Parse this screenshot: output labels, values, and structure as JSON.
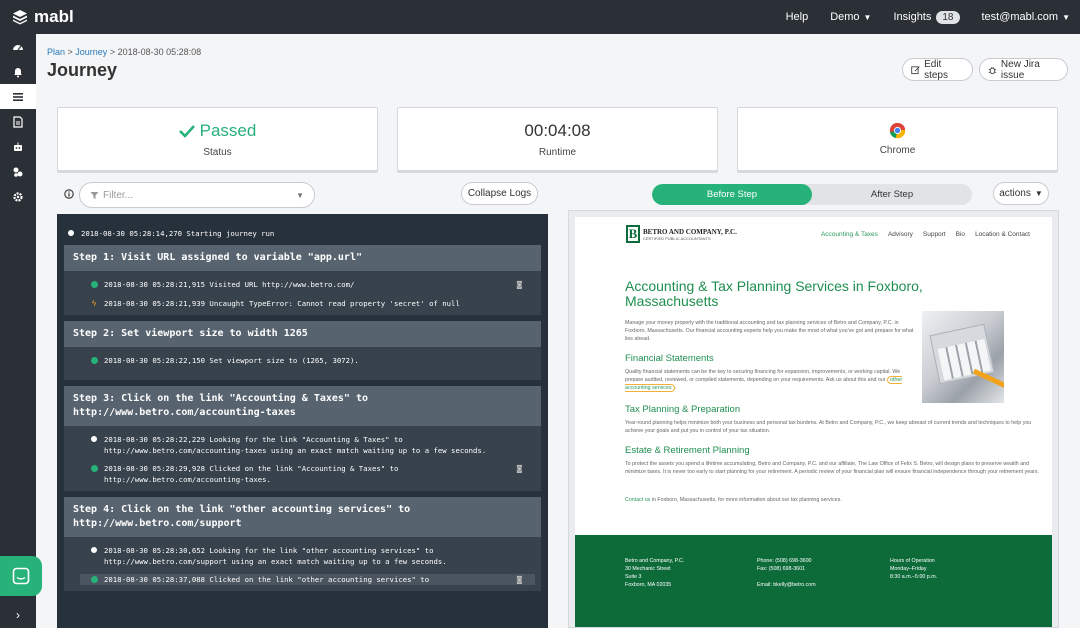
{
  "topbar": {
    "brand": "mabl",
    "help": "Help",
    "demo": "Demo",
    "insights": "Insights",
    "insights_count": "18",
    "user": "test@mabl.com"
  },
  "sidebar": {
    "items": [
      "dashboard-icon",
      "bell-icon",
      "list-icon",
      "document-icon",
      "robot-icon",
      "puzzle-icon",
      "gear-icon"
    ],
    "active_index": 2,
    "expand": "›"
  },
  "header": {
    "breadcrumb_plan": "Plan",
    "breadcrumb_sep1": " > ",
    "breadcrumb_journey": "Journey",
    "breadcrumb_sep2": " > ",
    "breadcrumb_run": "2018-08-30 05:28:08",
    "title": "Journey",
    "edit_steps": "Edit steps",
    "new_jira": "New Jira issue"
  },
  "cards": {
    "status_value": "Passed",
    "status_label": "Status",
    "runtime_value": "00:04:08",
    "runtime_label": "Runtime",
    "browser_label": "Chrome"
  },
  "toolbar": {
    "filter_placeholder": "Filter...",
    "collapse_logs": "Collapse Logs",
    "before_step": "Before Step",
    "after_step": "After Step",
    "actions": "actions"
  },
  "log": {
    "start": "2018-08-30 05:28:14,270 Starting journey run",
    "steps": [
      {
        "title": "Step 1: Visit URL assigned to variable \"app.url\"",
        "lines": [
          {
            "icon": "ok",
            "text": "2018-08-30 05:28:21,915 Visited URL http://www.betro.com/",
            "camera": true
          },
          {
            "icon": "warn",
            "text": "2018-08-30 05:28:21,939 Uncaught TypeError: Cannot read property 'secret' of null",
            "camera": false
          }
        ]
      },
      {
        "title": "Step 2: Set viewport size to width 1265",
        "lines": [
          {
            "icon": "ok",
            "text": "2018-08-30 05:28:22,150 Set viewport size to (1265, 3072).",
            "camera": false
          }
        ]
      },
      {
        "title": "Step 3: Click on the link \"Accounting & Taxes\" to http://www.betro.com/accounting-taxes",
        "lines": [
          {
            "icon": "info",
            "text": "2018-08-30 05:28:22,229 Looking for the link \"Accounting & Taxes\" to http://www.betro.com/accounting-taxes using an exact match waiting up to a few seconds.",
            "camera": false
          },
          {
            "icon": "ok",
            "text": "2018-08-30 05:28:29,928 Clicked on the link \"Accounting & Taxes\" to http://www.betro.com/accounting-taxes.",
            "camera": true
          }
        ]
      },
      {
        "title": "Step 4: Click on the link \"other accounting services\" to http://www.betro.com/support",
        "lines": [
          {
            "icon": "info",
            "text": "2018-08-30 05:28:30,652 Looking for the link \"other accounting services\" to http://www.betro.com/support using an exact match waiting up to a few seconds.",
            "camera": false
          },
          {
            "icon": "ok",
            "text": "2018-08-30 05:28:37,088 Clicked on the link \"other accounting services\" to",
            "camera": true
          }
        ]
      }
    ]
  },
  "site": {
    "brand": "BETRO AND COMPANY, P.C.",
    "brand_sub": "CERTIFIED PUBLIC ACCOUNTANTS",
    "logo_letter": "B",
    "nav": [
      "Accounting & Taxes",
      "Advisory",
      "Support",
      "Bio",
      "Location & Contact"
    ],
    "heading": "Accounting & Tax Planning Services in Foxboro, Massachusetts",
    "intro": "Manage your money properly with the traditional accounting and tax planning services of Betro and Company, P.C. in Foxboro, Massachusetts. Our financial accounting experts help you make the most of what you've got and prepare for what lies ahead.",
    "fin_title": "Financial Statements",
    "fin_text": "Quality financial statements can be the key to securing financing for expansion, improvements, or working capital. We prepare audited, reviewed, or compiled statements, depending on your requirements. Ask us about this and our",
    "fin_link": "other accounting services",
    "fin_end": ".",
    "tax_title": "Tax Planning & Preparation",
    "tax_text": "Year-round planning helps minimize both your business and personal tax burdens. At Betro and Company, P.C., we keep abreast of current trends and techniques to help you achieve your goals and put you in control of your tax situation.",
    "estate_title": "Estate & Retirement Planning",
    "estate_text": "To protect the assets you spend a lifetime accumulating, Betro and Company, P.C. and our affiliate, The Law Office of Felix S. Betro, will design plans to preserve wealth and minimize taxes. It is never too early to start planning for your retirement. A periodic review of your financial plan will ensure financial independence through your retirement years.",
    "contact_link": "Contact us",
    "contact_text": " in Foxboro, Massachusetts, for more information about our tax planning services.",
    "footer": {
      "col1": [
        "Betro and Company, P.C.",
        "30 Mechanic Street",
        "Suite 3",
        "Foxboro, MA 02035"
      ],
      "col2": [
        "Phone: (508) 698-3600",
        "Fax: (508) 698-3601",
        "",
        "Email: bkelly@betro.com"
      ],
      "col3": [
        "Hours of Operation",
        "Monday–Friday",
        "8:30 a.m.–5:00 p.m."
      ]
    }
  },
  "colors": {
    "topbar": "#2b2f36",
    "success": "#27b27a",
    "log_bg": "#27313b",
    "site_green": "#0d6b3a"
  }
}
